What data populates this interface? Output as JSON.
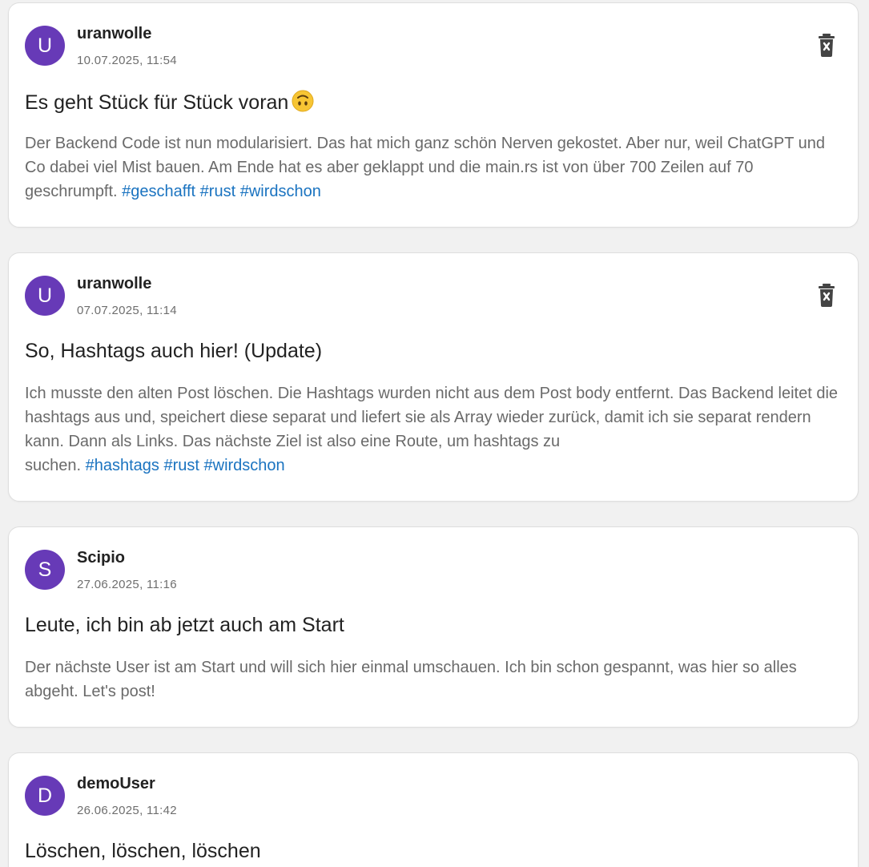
{
  "colors": {
    "avatar": "#673ab7",
    "hashtag": "#1a73c0",
    "body_text": "#6a6a6a",
    "card_bg": "#ffffff",
    "page_bg": "#f1f1f1"
  },
  "posts": [
    {
      "avatar_letter": "U",
      "author": "uranwolle",
      "timestamp": "10.07.2025, 11:54",
      "title": "Es geht Stück für Stück voran",
      "title_emoji": "upside-down-face-icon",
      "body": "Der Backend Code ist nun modularisiert. Das hat mich ganz schön Nerven gekostet. Aber nur, weil ChatGPT und Co dabei viel Mist bauen. Am Ende hat es aber geklappt und die main.rs ist von über 700 Zeilen auf 70 geschrumpft.",
      "hashtags": [
        "#geschafft",
        "#rust",
        "#wirdschon"
      ],
      "deletable": true
    },
    {
      "avatar_letter": "U",
      "author": "uranwolle",
      "timestamp": "07.07.2025, 11:14",
      "title": "So, Hashtags auch hier! (Update)",
      "body": "Ich musste den alten Post löschen. Die Hashtags wurden nicht aus dem Post body entfernt. Das Backend leitet die hashtags aus und, speichert diese separat und liefert sie als Array wieder zurück, damit ich sie separat rendern kann. Dann als Links. Das nächste Ziel ist also eine Route, um hashtags zu",
      "body_tail": "suchen.",
      "hashtags": [
        "#hashtags",
        "#rust",
        "#wirdschon"
      ],
      "deletable": true
    },
    {
      "avatar_letter": "S",
      "author": "Scipio",
      "timestamp": "27.06.2025, 11:16",
      "title": "Leute, ich bin ab jetzt auch am Start",
      "body": "Der nächste User ist am Start und will sich hier einmal umschauen. Ich bin schon gespannt, was hier so alles abgeht. Let's post!",
      "hashtags": [],
      "deletable": false
    },
    {
      "avatar_letter": "D",
      "author": "demoUser",
      "timestamp": "26.06.2025, 11:42",
      "title": "Löschen, löschen, löschen",
      "body": "",
      "hashtags": [],
      "deletable": false
    }
  ]
}
